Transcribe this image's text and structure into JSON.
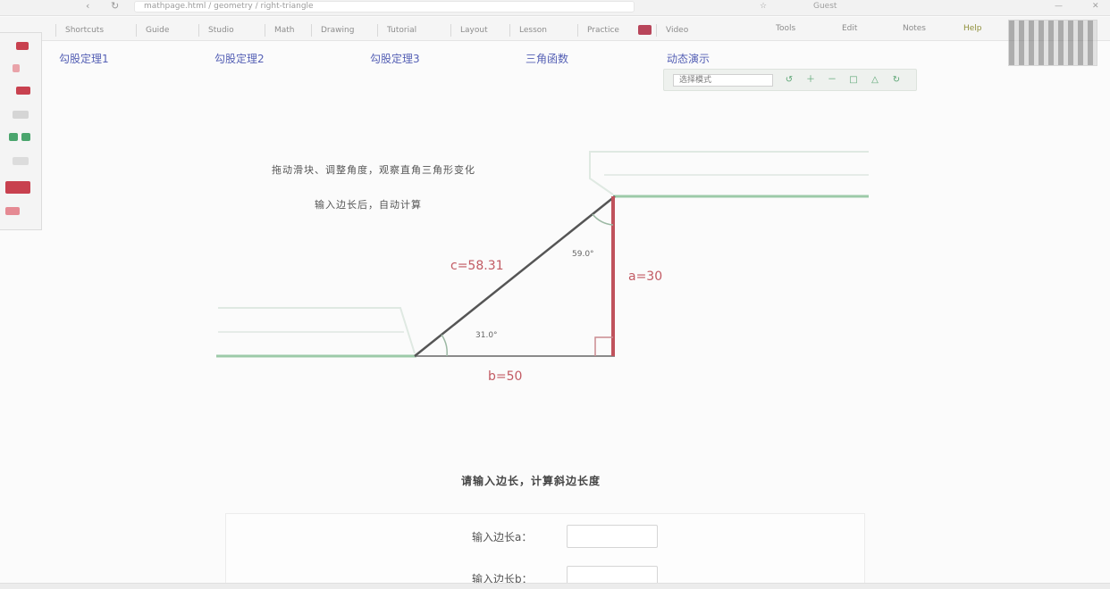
{
  "browser": {
    "back_glyph": "‹",
    "reload_glyph": "↻",
    "url": "mathpage.html / geometry / right-triangle",
    "topbar_right": [
      "☆",
      "Guest",
      "—",
      "✕"
    ]
  },
  "bookmarks": [
    "Shortcuts",
    "Guide",
    "Studio",
    "Math",
    "Drawing",
    "Tutorial",
    "Layout",
    "Lesson",
    "Practice",
    "Video"
  ],
  "bookmarks_right": [
    "Tools",
    "Edit",
    "Notes",
    "Help"
  ],
  "page_tabs": [
    "勾股定理1",
    "勾股定理2",
    "勾股定理3",
    "三角函数",
    "动态演示"
  ],
  "tool_strip": {
    "select_value": "选择模式",
    "buttons": [
      "↺",
      "＋",
      "－",
      "□",
      "△",
      "↻"
    ]
  },
  "instructions": {
    "line1": "拖动滑块、调整角度，观察直角三角形变化",
    "line2": "输入边长后，自动计算"
  },
  "diagram": {
    "hypotenuse_label": "c=58.31",
    "vertical_label": "a=30",
    "base_label": "b=50",
    "top_angle_label": "59.0°",
    "bottom_angle_label": "31.0°",
    "colors": {
      "hypotenuse": "#555555",
      "vertical": "#c0525c",
      "base": "#8a8a8a",
      "ground": "#9ccaa8",
      "label": "#c25a63"
    }
  },
  "form": {
    "heading": "请输入边长，计算斜边长度",
    "fields": [
      {
        "label": "输入边长a：",
        "value": "",
        "placeholder": ""
      },
      {
        "label": "输入边长b：",
        "value": "",
        "placeholder": ""
      }
    ]
  }
}
